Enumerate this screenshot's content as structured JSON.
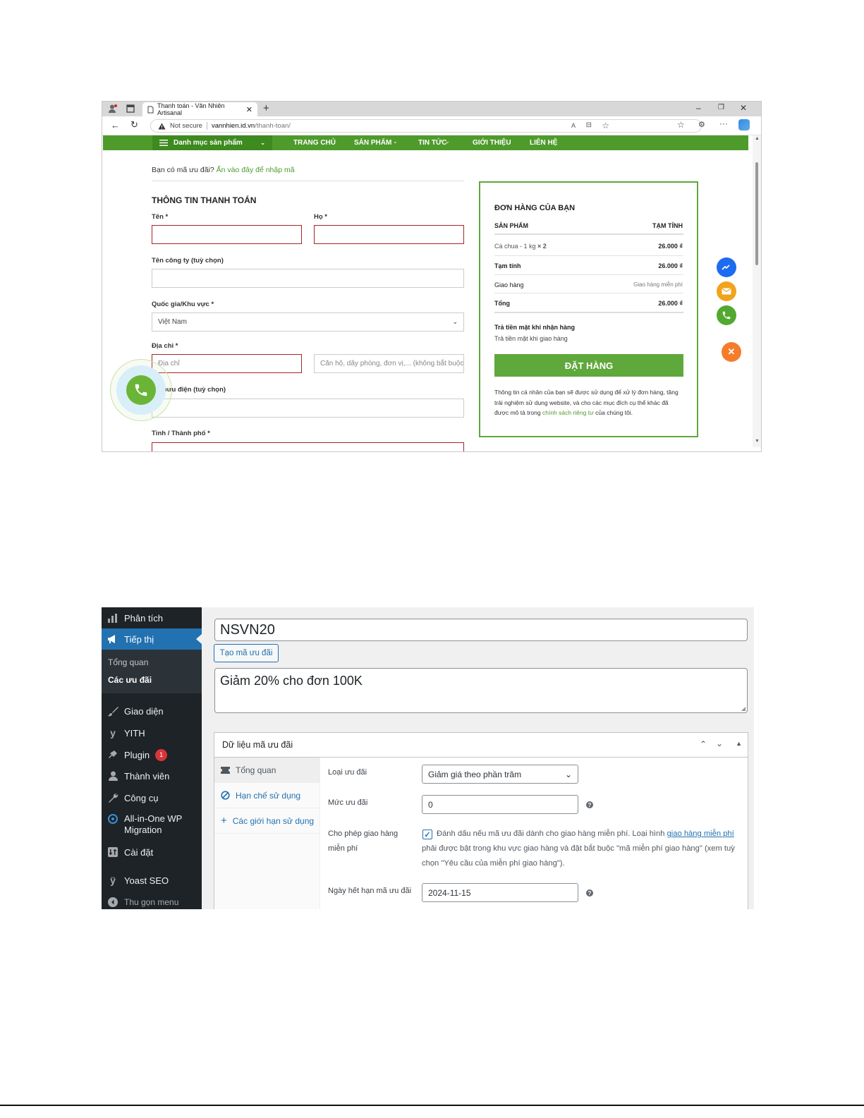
{
  "browser": {
    "tab_title": "Thanh toán - Văn Nhiên Artisanal",
    "security_label": "Not secure",
    "url_domain": "vannhien.id.vn",
    "url_path": "/thanh-toan/"
  },
  "site_nav": {
    "category_label": "Danh mục sản phẩm",
    "items": [
      "TRANG CHỦ",
      "SẢN PHẨM",
      "TIN TỨC",
      "GIỚI THIỆU",
      "LIÊN HỆ"
    ]
  },
  "checkout": {
    "coupon_prompt": "Bạn có mã ưu đãi?",
    "coupon_link": "Ấn vào đây để nhập mã",
    "billing_title": "THÔNG TIN THANH TOÁN",
    "first_name_label": "Tên *",
    "last_name_label": "Họ *",
    "company_label": "Tên công ty (tuỳ chọn)",
    "country_label": "Quốc gia/Khu vực *",
    "country_value": "Việt Nam",
    "address_label": "Địa chỉ *",
    "address_placeholder": "Địa chỉ",
    "address2_placeholder": "Căn hộ, dãy phòng, đơn vị,... (không bắt buộc)",
    "postcode_label": "Mã bưu điện (tuỳ chọn)",
    "city_label": "Tỉnh / Thành phố *"
  },
  "order": {
    "title": "ĐƠN HÀNG CỦA BẠN",
    "col_product": "SẢN PHẨM",
    "col_subtotal": "TẠM TÍNH",
    "item_name": "Cà chua - 1 kg",
    "item_qty": "× 2",
    "item_price": "26.000 ₫",
    "subtotal_label": "Tạm tính",
    "subtotal_value": "26.000 ₫",
    "shipping_label": "Giao hàng",
    "shipping_value": "Giao hàng miễn phí",
    "total_label": "Tổng",
    "total_value": "26.000 ₫",
    "payment_title": "Trả tiền mặt khi nhận hàng",
    "payment_desc": "Trả tiền mặt khi giao hàng",
    "place_order": "ĐẶT HÀNG",
    "privacy_text_1": "Thông tin cá nhân của bạn sẽ được sử dụng để xử lý đơn hàng, tăng trải nghiệm sử dụng website, và cho các mục đích cụ thể khác đã được mô tả trong",
    "privacy_link": "chính sách riêng tư",
    "privacy_text_2": "của chúng tôi."
  },
  "wp_menu": {
    "items": [
      {
        "label": "Phân tích",
        "icon": "chart-bar-icon"
      },
      {
        "label": "Tiếp thị",
        "icon": "megaphone-icon"
      },
      {
        "label": "Giao diện",
        "icon": "paintbrush-icon"
      },
      {
        "label": "YITH",
        "icon": "yith-icon"
      },
      {
        "label": "Plugin",
        "icon": "plugin-icon",
        "badge": "1"
      },
      {
        "label": "Thành viên",
        "icon": "user-icon"
      },
      {
        "label": "Công cụ",
        "icon": "wrench-icon"
      },
      {
        "label": "All-in-One WP Migration",
        "icon": "migration-icon"
      },
      {
        "label": "Cài đặt",
        "icon": "settings-icon"
      },
      {
        "label": "Yoast SEO",
        "icon": "yoast-icon"
      },
      {
        "label": "Thu gọn menu",
        "icon": "collapse-icon"
      }
    ],
    "submenu": [
      "Tổng quan",
      "Các ưu đãi"
    ]
  },
  "coupon": {
    "code": "NSVN20",
    "generate_label": "Tạo mã ưu đãi",
    "description": "Giảm 20% cho đơn 100K",
    "box_title": "Dữ liệu mã ưu đãi",
    "tabs": [
      "Tổng quan",
      "Hạn chế sử dụng",
      "Các giới hạn sử dụng"
    ],
    "type_label": "Loại ưu đãi",
    "type_value": "Giảm giá theo phần trăm",
    "amount_label": "Mức ưu đãi",
    "amount_value": "0",
    "free_shipping_label_1": "Cho phép giao hàng",
    "free_shipping_label_2": "miễn phí",
    "free_shipping_checked": true,
    "free_shipping_text_1": "Đánh dấu nếu mã ưu đãi dành cho giao hàng miễn phí. Loại hình",
    "free_shipping_link_1": "giao hàng miễn",
    "free_shipping_link_2": "phí",
    "free_shipping_text_2": "phải được bật trong khu vực giao hàng và đặt bắt buộc \"mã miễn phí giao hàng\"",
    "free_shipping_text_3": "(xem tuỳ chọn \"Yêu cầu của miễn phí giao hàng\").",
    "expiry_label": "Ngày hết hạn mã ưu đãi",
    "expiry_value": "2024-11-15"
  },
  "colors": {
    "site_green": "#4e9b2c",
    "wp_sidebar": "#1d2327",
    "wp_accent": "#2271b1",
    "error_border": "#a3252b"
  }
}
